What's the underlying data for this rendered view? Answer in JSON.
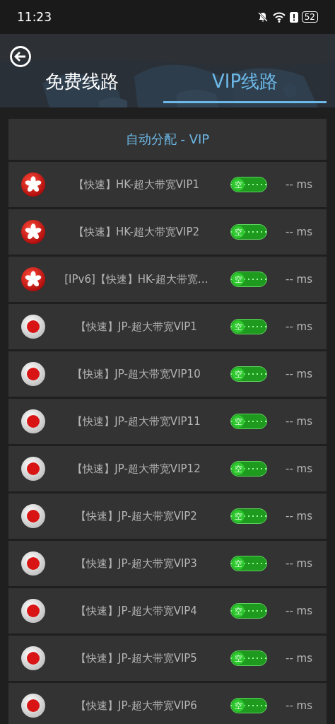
{
  "status_bar": {
    "time": "11:23",
    "battery": "52"
  },
  "header": {
    "tabs": [
      {
        "label": "免费线路",
        "selected": false
      },
      {
        "label": "VIP线路",
        "selected": true
      }
    ]
  },
  "auto_item": {
    "label": "自动分配 - VIP"
  },
  "lines": [
    {
      "kind": "hk",
      "name": "【快速】HK-超大带宽VIP1",
      "load": "空",
      "ping": "-- ms"
    },
    {
      "kind": "hk",
      "name": "【快速】HK-超大带宽VIP2",
      "load": "空",
      "ping": "-- ms"
    },
    {
      "kind": "hk",
      "name": "[IPv6]【快速】HK-超大带宽…",
      "load": "空",
      "ping": "-- ms"
    },
    {
      "kind": "jp",
      "name": "【快速】JP-超大带宽VIP1",
      "load": "空",
      "ping": "-- ms"
    },
    {
      "kind": "jp",
      "name": "【快速】JP-超大带宽VIP10",
      "load": "空",
      "ping": "-- ms"
    },
    {
      "kind": "jp",
      "name": "【快速】JP-超大带宽VIP11",
      "load": "空",
      "ping": "-- ms"
    },
    {
      "kind": "jp",
      "name": "【快速】JP-超大带宽VIP12",
      "load": "空",
      "ping": "-- ms"
    },
    {
      "kind": "jp",
      "name": "【快速】JP-超大带宽VIP2",
      "load": "空",
      "ping": "-- ms"
    },
    {
      "kind": "jp",
      "name": "【快速】JP-超大带宽VIP3",
      "load": "空",
      "ping": "-- ms"
    },
    {
      "kind": "jp",
      "name": "【快速】JP-超大带宽VIP4",
      "load": "空",
      "ping": "-- ms"
    },
    {
      "kind": "jp",
      "name": "【快速】JP-超大带宽VIP5",
      "load": "空",
      "ping": "-- ms"
    },
    {
      "kind": "jp",
      "name": "【快速】JP-超大带宽VIP6",
      "load": "空",
      "ping": "-- ms"
    }
  ]
}
